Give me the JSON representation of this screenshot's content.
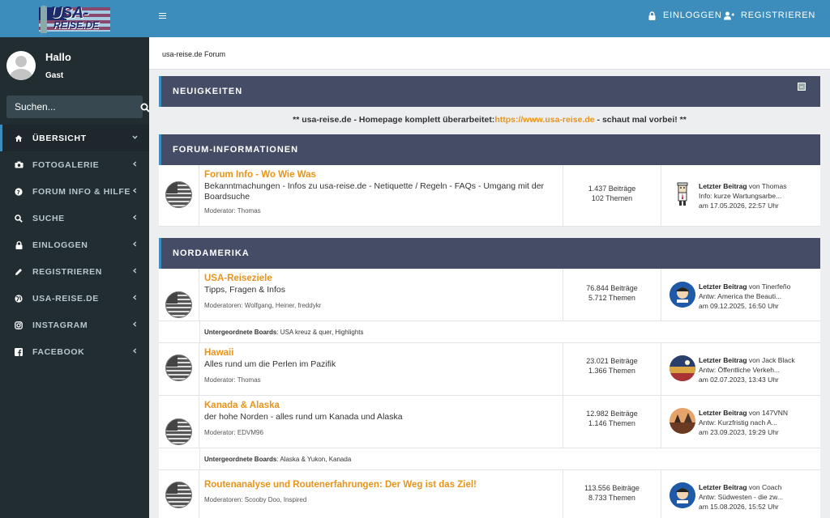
{
  "logo": {
    "line1": "USA-",
    "line2": "REISE.DE"
  },
  "user": {
    "greeting": "Hallo",
    "name": "Gast"
  },
  "search": {
    "placeholder": "Suchen..."
  },
  "menu": [
    {
      "label": "ÜBERSICHT",
      "icon": "home-icon"
    },
    {
      "label": "FOTOGALERIE",
      "icon": "camera-icon"
    },
    {
      "label": "FORUM INFO & HILFE",
      "icon": "question-circle-icon"
    },
    {
      "label": "SUCHE",
      "icon": "search-icon"
    },
    {
      "label": "EINLOGGEN",
      "icon": "lock-icon"
    },
    {
      "label": "REGISTRIEREN",
      "icon": "pencil-icon"
    },
    {
      "label": "USA-REISE.DE",
      "icon": "globe-icon"
    },
    {
      "label": "INSTAGRAM",
      "icon": "instagram-icon"
    },
    {
      "label": "FACEBOOK",
      "icon": "facebook-icon"
    }
  ],
  "header": {
    "login": "EINLOGGEN",
    "register": "REGISTRIEREN"
  },
  "breadcrumb": "usa-reise.de Forum",
  "news": {
    "title": "NEUIGKEITEN",
    "text_before": "** usa-reise.de - Homepage komplett überarbeitet:",
    "link": "https://www.usa-reise.de",
    "text_after": " - schaut mal vorbei! **"
  },
  "categories": {
    "forum_info": {
      "title": "FORUM-INFORMATIONEN",
      "boards": [
        {
          "title": "Forum Info - Wo Wie Was",
          "desc": "Bekanntmachungen - Infos zu usa-reise.de - Netiquette / Regeln - FAQs - Umgang mit der Boardsuche",
          "mod": "Moderator: Thomas",
          "posts": "1.437 Beiträge",
          "topics": "102 Themen",
          "last_label": "Letzter Beitrag",
          "last_by": " von Thomas",
          "last_topic": "Info: kurze Wartungsarbe...",
          "last_date": "am 17.05.2026, 22:57 Uhr"
        }
      ]
    },
    "nordamerika": {
      "title": "NORDAMERIKA",
      "boards": [
        {
          "title": "USA-Reiseziele",
          "desc": "Tipps, Fragen & Infos",
          "mod": "Moderatoren: Wolfgang, Heiner, freddykr",
          "posts": "76.844 Beiträge",
          "topics": "5.712 Themen",
          "last_label": "Letzter Beitrag",
          "last_by": " von Tinerfeño",
          "last_topic": "Antw: America the Beauti...",
          "last_date": "am 09.12.2025, 16:50 Uhr",
          "sub_label": "Untergeordnete Boards",
          "sub_value": ": USA kreuz & quer, Highlights"
        },
        {
          "title": "Hawaii",
          "desc": "Alles rund um die Perlen im Pazifik",
          "mod": "Moderator: Thomas",
          "posts": "23.021 Beiträge",
          "topics": "1.366 Themen",
          "last_label": "Letzter Beitrag",
          "last_by": " von Jack Black",
          "last_topic": "Antw: Öffentliche Verkeh...",
          "last_date": "am 02.07.2023, 13:43 Uhr"
        },
        {
          "title": "Kanada & Alaska",
          "desc": "der hohe Norden - alles rund um Kanada und Alaska",
          "mod": "Moderator: EDVM96",
          "posts": "12.982 Beiträge",
          "topics": "1.146 Themen",
          "last_label": "Letzter Beitrag",
          "last_by": " von 147VNN",
          "last_topic": "Antw: Kurzfristig nach A...",
          "last_date": "am 23.09.2023, 19:29 Uhr",
          "sub_label": "Untergeordnete Boards",
          "sub_value": ": Alaska & Yukon, Kanada"
        },
        {
          "title": "Routenanalyse und Routenerfahrungen: Der Weg ist das Ziel!",
          "mod": "Moderatoren: Scooby Doo, Inspired",
          "posts": "113.556 Beiträge",
          "topics": "8.733 Themen",
          "last_label": "Letzter Beitrag",
          "last_by": " von Coach",
          "last_topic": "Antw: Südwesten - die zw...",
          "last_date": "am 15.08.2026, 15:52 Uhr"
        }
      ]
    }
  }
}
